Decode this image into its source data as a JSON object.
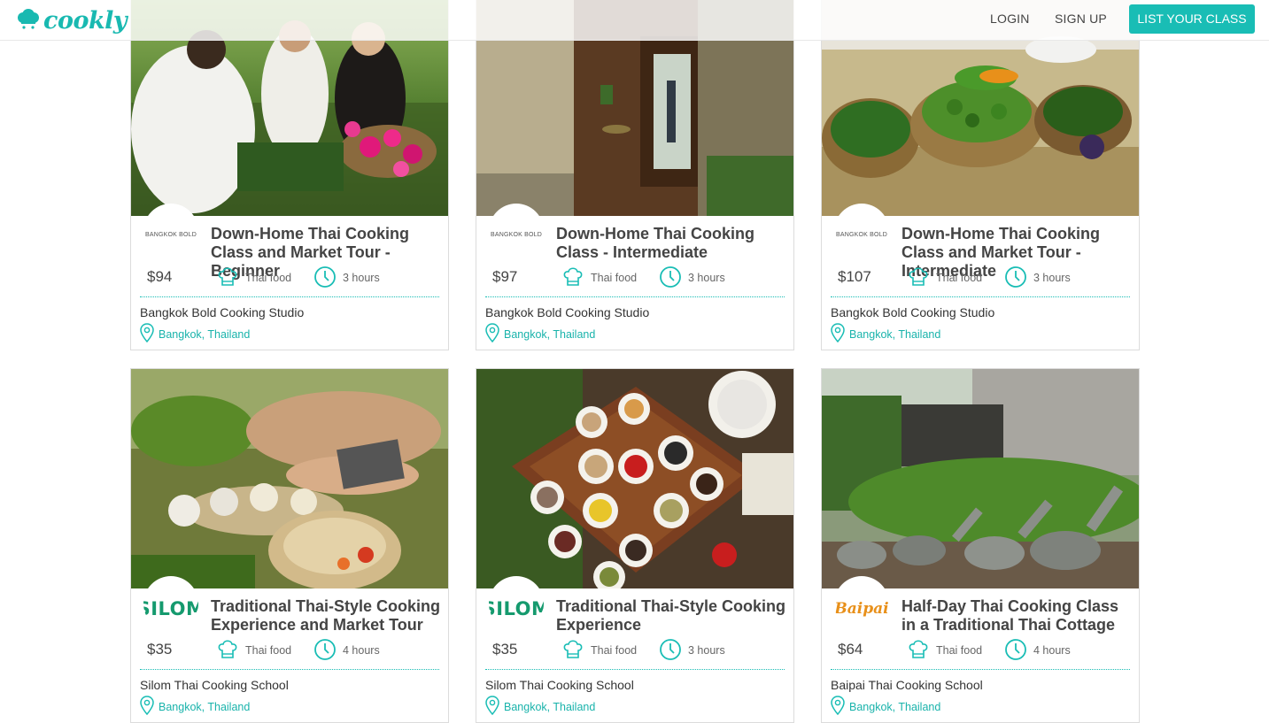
{
  "header": {
    "logo_text": "cookly",
    "login_label": "LOGIN",
    "signup_label": "SIGN UP",
    "list_class_label": "LIST YOUR CLASS"
  },
  "colors": {
    "accent": "#19bdb5"
  },
  "cards": [
    {
      "school_logo_text": "BANGKOK BOLD",
      "title": "Down-Home Thai Cooking Class and Market Tour - Beginner",
      "price": "$94",
      "cuisine": "Thai food",
      "duration": "3 hours",
      "school": "Bangkok Bold Cooking Studio",
      "location": "Bangkok, Thailand",
      "image_icon": "market-photo"
    },
    {
      "school_logo_text": "BANGKOK BOLD",
      "title": "Down-Home Thai Cooking Class - Intermediate",
      "price": "$97",
      "cuisine": "Thai food",
      "duration": "3 hours",
      "school": "Bangkok Bold Cooking Studio",
      "location": "Bangkok, Thailand",
      "image_icon": "doorway-photo"
    },
    {
      "school_logo_text": "BANGKOK BOLD",
      "title": "Down-Home Thai Cooking Class and Market Tour - Intermediate",
      "price": "$107",
      "cuisine": "Thai food",
      "duration": "3 hours",
      "school": "Bangkok Bold Cooking Studio",
      "location": "Bangkok, Thailand",
      "image_icon": "vegetables-photo"
    },
    {
      "school_logo_text": "SILOM",
      "title": "Traditional Thai-Style Cooking Experience and Market Tour",
      "price": "$35",
      "cuisine": "Thai food",
      "duration": "4 hours",
      "school": "Silom Thai Cooking School",
      "location": "Bangkok, Thailand",
      "image_icon": "ingredients-photo"
    },
    {
      "school_logo_text": "SILOM",
      "title": "Traditional Thai-Style Cooking Experience",
      "price": "$35",
      "cuisine": "Thai food",
      "duration": "3 hours",
      "school": "Silom Thai Cooking School",
      "location": "Bangkok, Thailand",
      "image_icon": "spices-photo"
    },
    {
      "school_logo_text": "Baipai",
      "title": "Half-Day Thai Cooking Class in a Traditional Thai Cottage",
      "price": "$64",
      "cuisine": "Thai food",
      "duration": "4 hours",
      "school": "Baipai Thai Cooking School",
      "location": "Bangkok, Thailand",
      "image_icon": "mortars-photo"
    }
  ]
}
